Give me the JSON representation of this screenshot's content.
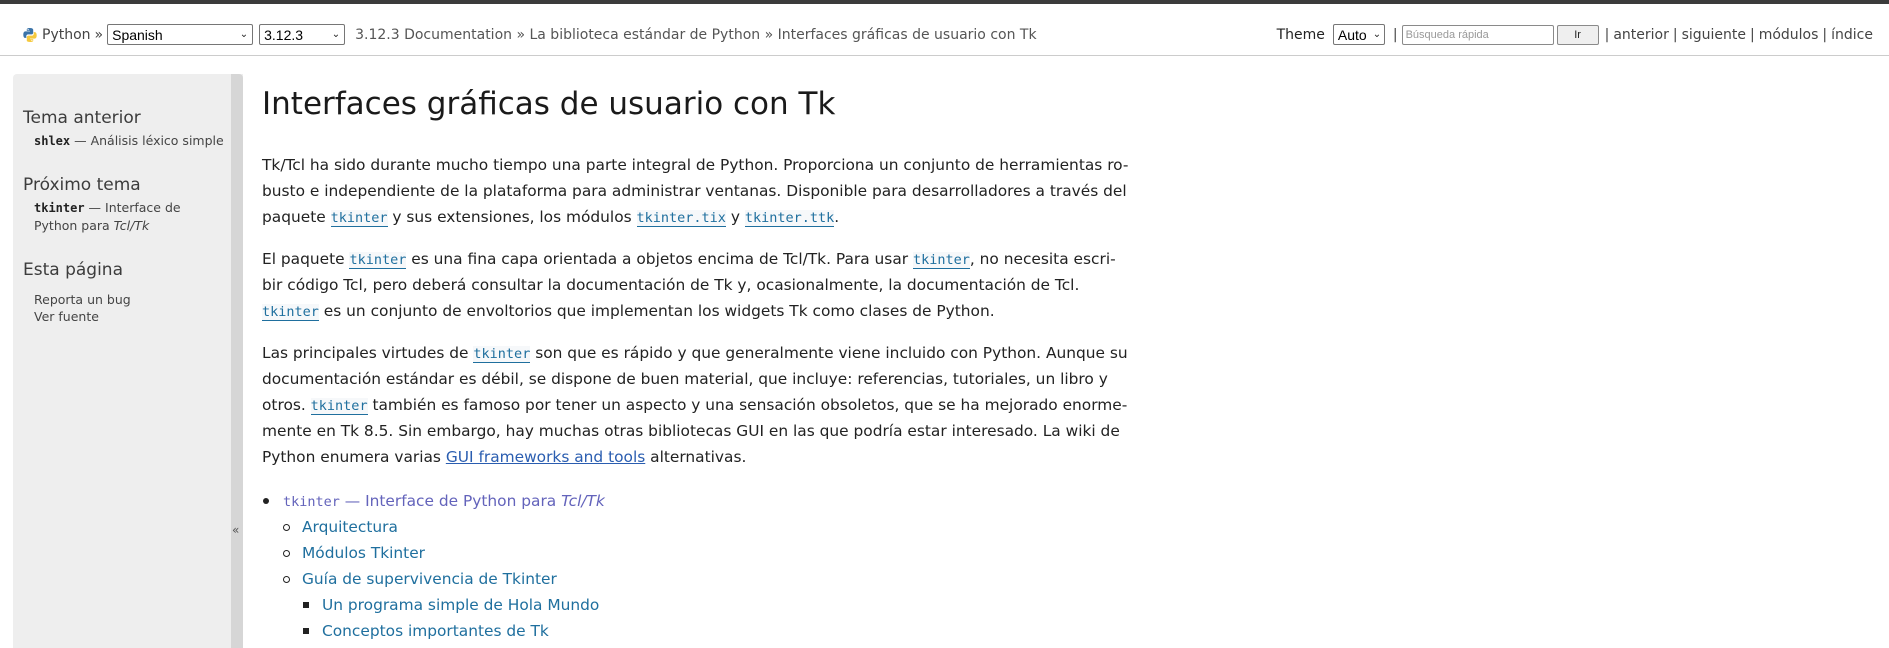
{
  "related": {
    "python_label": "Python",
    "sep": "»",
    "language": "Spanish",
    "version": "3.12.3",
    "breadcrumb": "3.12.3 Documentation » La biblioteca estándar de Python » Interfaces gráficas de usuario con Tk",
    "theme_label": "Theme",
    "theme_value": "Auto",
    "search_placeholder": "Búsqueda rápida",
    "go_label": "Ir",
    "pipe": "|",
    "nav": {
      "prev": "anterior",
      "next": "siguiente",
      "modules": "módulos",
      "index": "índice"
    }
  },
  "sidebar": {
    "prev_heading": "Tema anterior",
    "prev_code": "shlex",
    "prev_text": " — Análisis léxico simple",
    "next_heading": "Próximo tema",
    "next_code": "tkinter",
    "next_text_a": " — Interface de",
    "next_text_b": "Python para ",
    "next_text_c": "Tcl/Tk",
    "page_heading": "Esta página",
    "report_bug": "Reporta un bug",
    "view_source": "Ver fuente",
    "collapse_glyph": "«"
  },
  "main": {
    "title": "Interfaces gráficas de usuario con Tk",
    "p1": {
      "l1": "Tk/Tcl ha sido durante mucho tiempo una parte integral de Python. Proporciona un conjunto de herramientas ro-",
      "l2": "busto e independiente de la plataforma para administrar ventanas. Disponible para desarrolladores a través del",
      "l3a": "paquete ",
      "tkinter": "tkinter",
      "l3b": " y sus extensiones, los módulos ",
      "tix": "tkinter.tix",
      "l3c": " y ",
      "ttk": "tkinter.ttk",
      "l3d": "."
    },
    "p2": {
      "l1a": "El paquete ",
      "tkinter": "tkinter",
      "l1b": " es una fina capa orientada a objetos encima de Tcl/Tk. Para usar ",
      "l1c": ", no necesita escri-",
      "l2": "bir código Tcl, pero deberá consultar la documentación de Tk y, ocasionalmente, la documentación de Tcl.",
      "l3b": " es un conjunto de envoltorios que implementan los widgets Tk como clases de Python."
    },
    "p3": {
      "l1a": "Las principales virtudes de ",
      "tkinter": "tkinter",
      "l1b": " son que es rápido y que generalmente viene incluido con Python. Aunque su",
      "l2": "documentación estándar es débil, se dispone de buen material, que incluye: referencias, tutoriales, un libro y",
      "l3a": "otros. ",
      "l3b": " también es famoso por tener un aspecto y una sensación obsoletos, que se ha mejorado enorme-",
      "l4": "mente en Tk 8.5. Sin embargo, hay muchas otras bibliotecas GUI en las que podría estar interesado. La wiki de",
      "l5a": "Python enumera varias ",
      "gui_link": "GUI frameworks and tools",
      "l5b": " alternativas."
    },
    "toc": {
      "main_code": "tkinter",
      "main_text": " — Interface de Python para ",
      "main_italic": "Tcl/Tk",
      "items": [
        "Arquitectura",
        "Módulos Tkinter",
        "Guía de supervivencia de Tkinter"
      ],
      "subitems": [
        "Un programa simple de Hola Mundo",
        "Conceptos importantes de Tk"
      ]
    }
  }
}
